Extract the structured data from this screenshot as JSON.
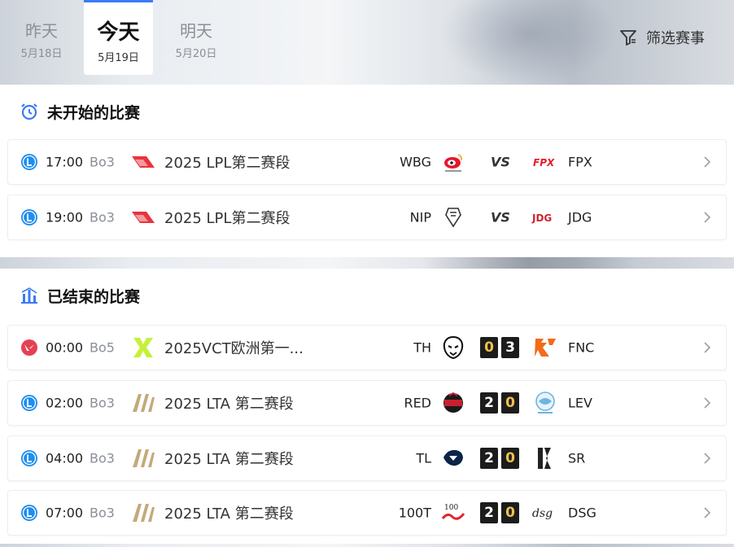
{
  "tabs": [
    {
      "day": "昨天",
      "date": "5月18日"
    },
    {
      "day": "今天",
      "date": "5月19日"
    },
    {
      "day": "明天",
      "date": "5月20日"
    }
  ],
  "filter_label": "筛选赛事",
  "sections": {
    "upcoming_title": "未开始的比赛",
    "finished_title": "已结束的比赛"
  },
  "upcoming": [
    {
      "time": "17:00",
      "bo": "Bo3",
      "league": "2025 LPL第二赛段",
      "team_a": "WBG",
      "vs": "VS",
      "team_b": "FPX"
    },
    {
      "time": "19:00",
      "bo": "Bo3",
      "league": "2025 LPL第二赛段",
      "team_a": "NIP",
      "vs": "VS",
      "team_b": "JDG"
    }
  ],
  "finished": [
    {
      "time": "00:00",
      "bo": "Bo5",
      "league": "2025VCT欧洲第一...",
      "team_a": "TH",
      "score_a": "0",
      "score_b": "3",
      "team_b": "FNC"
    },
    {
      "time": "02:00",
      "bo": "Bo3",
      "league": "2025 LTA 第二赛段",
      "team_a": "RED",
      "score_a": "2",
      "score_b": "0",
      "team_b": "LEV"
    },
    {
      "time": "04:00",
      "bo": "Bo3",
      "league": "2025 LTA 第二赛段",
      "team_a": "TL",
      "score_a": "2",
      "score_b": "0",
      "team_b": "SR"
    },
    {
      "time": "07:00",
      "bo": "Bo3",
      "league": "2025 LTA 第二赛段",
      "team_a": "100T",
      "score_a": "2",
      "score_b": "0",
      "team_b": "DSG"
    }
  ],
  "colors": {
    "accent": "#3b7bf5",
    "lol_icon": "#1e8ef0",
    "valorant_icon": "#e64153",
    "score_bg": "#1c1c1c",
    "score_loss": "#f2c14e"
  },
  "icons": {
    "filter": "filter-icon",
    "alarm": "alarm-clock-icon",
    "stats": "bar-chart-icon",
    "lol": "lol-game-icon",
    "valorant": "valorant-game-icon",
    "chevron": "chevron-right-icon"
  }
}
